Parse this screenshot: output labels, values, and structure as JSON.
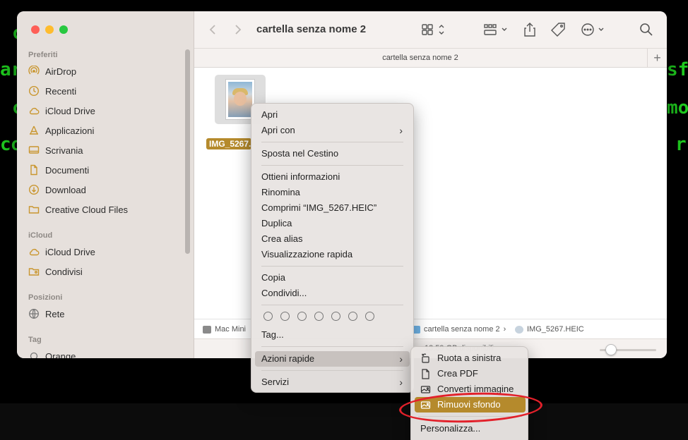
{
  "background": {
    "terminal_fragments": [
      "c",
      "ar",
      "c",
      "co",
      "sfo",
      "mo",
      "r"
    ],
    "terminal_color": "#1fcf1f"
  },
  "window": {
    "title": "cartella senza nome 2",
    "path_tab_title": "cartella senza nome 2",
    "tab_add_label": "+"
  },
  "sidebar": {
    "sections": {
      "favorites": "Preferiti",
      "icloud": "iCloud",
      "locations": "Posizioni",
      "tags": "Tag"
    },
    "favorites": [
      {
        "label": "AirDrop",
        "icon": "airdrop-icon"
      },
      {
        "label": "Recenti",
        "icon": "clock-icon"
      },
      {
        "label": "iCloud Drive",
        "icon": "cloud-icon"
      },
      {
        "label": "Applicazioni",
        "icon": "applications-icon"
      },
      {
        "label": "Scrivania",
        "icon": "desktop-icon"
      },
      {
        "label": "Documenti",
        "icon": "document-icon"
      },
      {
        "label": "Download",
        "icon": "download-icon"
      },
      {
        "label": "Creative Cloud Files",
        "icon": "folder-icon"
      }
    ],
    "icloud": [
      {
        "label": "iCloud Drive",
        "icon": "cloud-icon"
      },
      {
        "label": "Condivisi",
        "icon": "shared-folder-icon"
      }
    ],
    "locations": [
      {
        "label": "Rete",
        "icon": "globe-icon"
      }
    ],
    "tags": [
      {
        "label": "Orange",
        "icon": "tag-dot-icon"
      }
    ],
    "accent_color": "#c9962f"
  },
  "content": {
    "file": {
      "name": "IMG_5267.HEIC",
      "name_visible": "IMG_5267."
    }
  },
  "pathbar": {
    "items": [
      {
        "label": "Mac Mini",
        "icon": "mac-icon"
      },
      {
        "label": "cartella senza nome 2",
        "icon": "folder-icon"
      },
      {
        "label": "IMG_5267.HEIC",
        "icon": "image-file-icon"
      }
    ],
    "separator": "›"
  },
  "statusbar": {
    "text": "13,59 GB disponibili",
    "zoom_fraction": 0.2
  },
  "context_menu": {
    "items": {
      "open": "Apri",
      "open_with": "Apri con",
      "trash": "Sposta nel Cestino",
      "get_info": "Ottieni informazioni",
      "rename": "Rinomina",
      "compress": "Comprimi “IMG_5267.HEIC”",
      "duplicate": "Duplica",
      "make_alias": "Crea alias",
      "quick_look": "Visualizzazione rapida",
      "copy": "Copia",
      "share": "Condividi...",
      "tags": "Tag...",
      "quick_actions": "Azioni rapide",
      "services": "Servizi"
    },
    "submenu_chevron": "›",
    "tag_color_count": 7
  },
  "submenu": {
    "items": [
      {
        "label": "Ruota a sinistra",
        "icon": "rotate-left-icon"
      },
      {
        "label": "Crea PDF",
        "icon": "pdf-icon"
      },
      {
        "label": "Converti immagine",
        "icon": "convert-image-icon"
      },
      {
        "label": "Rimuovi sfondo",
        "icon": "remove-background-icon"
      }
    ],
    "customize": "Personalizza...",
    "highlight_color": "#b58a2c",
    "annotation_color": "#e2202a"
  }
}
